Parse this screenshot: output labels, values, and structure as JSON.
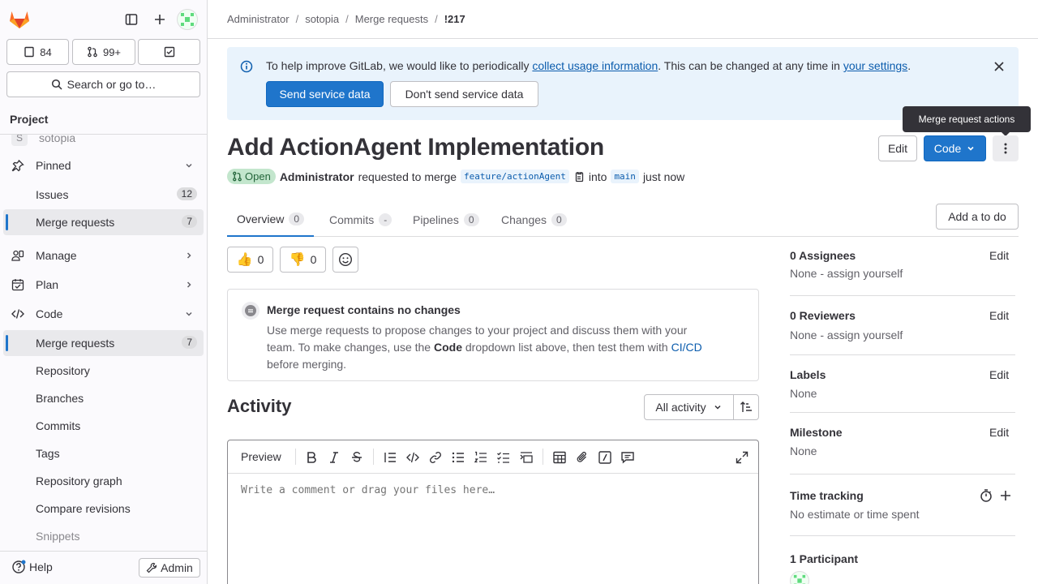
{
  "sidebar": {
    "counts": {
      "issues": "84",
      "merge_requests": "99+"
    },
    "search_label": "Search or go to…",
    "section_title": "Project",
    "project_name": "sotopia",
    "project_initial": "S",
    "items": [
      {
        "label": "Pinned"
      },
      {
        "label": "Issues",
        "badge": "12"
      },
      {
        "label": "Merge requests",
        "badge": "7"
      },
      {
        "label": "Manage"
      },
      {
        "label": "Plan"
      },
      {
        "label": "Code"
      },
      {
        "label": "Merge requests",
        "badge": "7"
      },
      {
        "label": "Repository"
      },
      {
        "label": "Branches"
      },
      {
        "label": "Commits"
      },
      {
        "label": "Tags"
      },
      {
        "label": "Repository graph"
      },
      {
        "label": "Compare revisions"
      },
      {
        "label": "Snippets"
      }
    ],
    "help_label": "Help",
    "admin_label": "Admin"
  },
  "breadcrumb": [
    "Administrator",
    "sotopia",
    "Merge requests",
    "!217"
  ],
  "banner": {
    "text_before": "To help improve GitLab, we would like to periodically ",
    "link1": "collect usage information",
    "text_middle": ". This can be changed at any time in ",
    "link2": "your settings",
    "text_after": ".",
    "send_label": "Send service data",
    "dont_send_label": "Don't send service data"
  },
  "mr": {
    "title": "Add ActionAgent Implementation",
    "status": "Open",
    "author": "Administrator",
    "requested_text": "requested to merge",
    "source_branch": "feature/actionAgent",
    "into_text": "into",
    "target_branch": "main",
    "time": "just now",
    "edit_label": "Edit",
    "code_label": "Code",
    "tooltip": "Merge request actions"
  },
  "tabs": [
    {
      "label": "Overview",
      "count": "0"
    },
    {
      "label": "Commits",
      "count": "-"
    },
    {
      "label": "Pipelines",
      "count": "0"
    },
    {
      "label": "Changes",
      "count": "0"
    }
  ],
  "add_todo_label": "Add a to do",
  "reactions": {
    "thumbs_up": "0",
    "thumbs_down": "0"
  },
  "no_changes": {
    "title": "Merge request contains no changes",
    "line1": "Use merge requests to propose changes to your project and discuss them with your",
    "line2_before": "team. To make changes, use the ",
    "line2_bold": "Code",
    "line2_after": " dropdown list above, then test them with ",
    "line2_link": "CI/CD",
    "line3": "before merging."
  },
  "activity": {
    "title": "Activity",
    "filter_label": "All activity"
  },
  "editor": {
    "preview_label": "Preview",
    "placeholder": "Write a comment or drag your files here…"
  },
  "right_sidebar": {
    "assignees_title": "0 Assignees",
    "assignees_value": "None - assign yourself",
    "reviewers_title": "0 Reviewers",
    "reviewers_value": "None - assign yourself",
    "labels_title": "Labels",
    "labels_value": "None",
    "milestone_title": "Milestone",
    "milestone_value": "None",
    "time_title": "Time tracking",
    "time_value": "No estimate or time spent",
    "participants_title": "1 Participant",
    "edit_label": "Edit"
  },
  "colors": {
    "brand": "#fc6d26",
    "primary": "#1f75cb",
    "open": "#24663b"
  }
}
